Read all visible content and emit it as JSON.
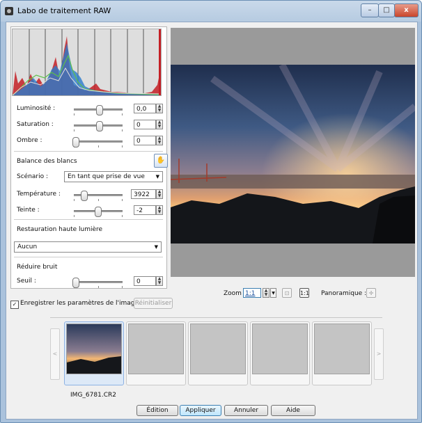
{
  "window": {
    "title": "Labo de traitement RAW",
    "minimize": "–",
    "maximize": "□",
    "close": "x"
  },
  "adjust": {
    "luminosite": {
      "label": "Luminosité :",
      "value": "0,0"
    },
    "saturation": {
      "label": "Saturation :",
      "value": "0"
    },
    "ombre": {
      "label": "Ombre :",
      "value": "0"
    }
  },
  "white_balance": {
    "heading": "Balance des blancs",
    "scenario_label": "Scénario :",
    "scenario_value": "En tant que prise de vue",
    "temperature_label": "Température :",
    "temperature_value": "3922",
    "teinte_label": "Teinte :",
    "teinte_value": "-2"
  },
  "highlight": {
    "heading": "Restauration haute lumière",
    "value": "Aucun"
  },
  "noise": {
    "heading": "Réduire bruit",
    "seuil_label": "Seuil :",
    "seuil_value": "0"
  },
  "save_params": {
    "label": "Enregistrer les paramètres de l'image",
    "checked": true
  },
  "reset_button": "Réinitialiser",
  "zoom": {
    "label": "Zoom :",
    "value": "1:1"
  },
  "pan": {
    "label": "Panoramique :"
  },
  "filmstrip": {
    "items": [
      {
        "caption": "IMG_6781.CR2"
      },
      {
        "caption": ""
      },
      {
        "caption": ""
      },
      {
        "caption": ""
      },
      {
        "caption": ""
      }
    ]
  },
  "footer": {
    "edit": "Édition",
    "apply": "Appliquer",
    "cancel": "Annuler",
    "help": "Aide"
  },
  "icons": {
    "hand": "hand-icon",
    "prev": "chevron-left-icon",
    "next": "chevron-right-icon",
    "fit": "fit-screen-icon",
    "actual": "actual-size-icon",
    "pan": "crosshair-icon"
  },
  "colors": {
    "accent": "#3c7fb1",
    "title_bar": "#b6cbe1"
  }
}
